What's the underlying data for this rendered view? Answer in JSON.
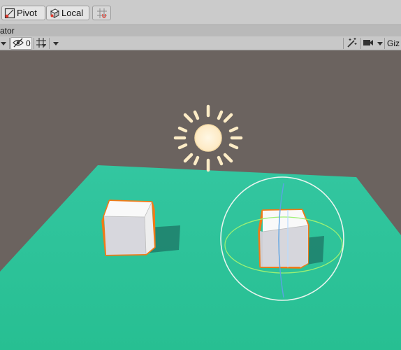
{
  "toolbar": {
    "pivot_label": "Pivot",
    "local_label": "Local"
  },
  "tab": {
    "label": "ator"
  },
  "scene_toolbar": {
    "hidden_count": "0",
    "gizmos_label": "Giz"
  },
  "colors": {
    "ground": "#2fc49a",
    "sky": "#6b635f",
    "selection_outline": "#f07a17",
    "sun": "#fff1d2"
  },
  "icons": [
    "pivot-icon",
    "local-icon",
    "grid-snap-icon",
    "visibility-hidden-icon",
    "grid-icon",
    "effects-icon",
    "camera-icon"
  ]
}
